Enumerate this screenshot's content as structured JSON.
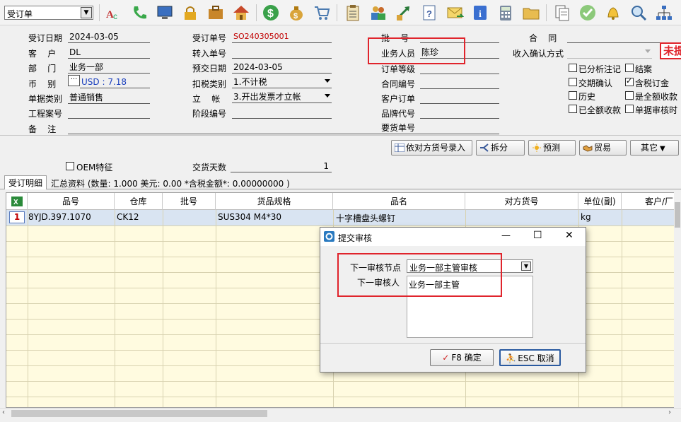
{
  "toolbar": {
    "doc_type": "受订单",
    "icons": [
      "spellcheck-icon",
      "phone-icon",
      "monitor-icon",
      "lock-icon",
      "briefcase-icon",
      "house-icon",
      "dollar-icon",
      "money-bag-icon",
      "cart-icon",
      "clipboard-icon",
      "users-icon",
      "transfer-icon",
      "help-doc-icon",
      "mail-icon",
      "info-icon",
      "calculator-icon",
      "folder-icon",
      "copy-doc-icon",
      "approve-icon",
      "bell-icon",
      "search-icon",
      "org-chart-icon"
    ]
  },
  "form": {
    "order_date_label": "受订日期",
    "order_date": "2024-03-05",
    "customer_label": "客    户",
    "customer": "DL",
    "dept_label": "部    门",
    "dept": "业务一部",
    "currency_label": "币    别",
    "currency": "USD : 7.18",
    "doc_category_label": "单据类别",
    "doc_category": "普通销售",
    "project_label": "工程案号",
    "project": "",
    "remark_label": "备    注",
    "remark": "",
    "order_no_label": "受订单号",
    "order_no": "SO240305001",
    "import_no_label": "转入单号",
    "import_no": "",
    "pre_date_label": "预交日期",
    "pre_date": "2024-03-05",
    "tax_type_label": "扣税类别",
    "tax_type": "1.不计税",
    "account_label": "立    帐",
    "account": "3.开出发票才立帐",
    "stage_label": "阶段编号",
    "stage": "",
    "batch_label": "批    号",
    "batch": "",
    "salesperson_label": "业务人员",
    "salesperson": "陈珍",
    "order_level_label": "订单等级",
    "order_level": "",
    "contract_no_label": "合同编号",
    "contract_no": "",
    "cust_order_label": "客户订单",
    "cust_order": "",
    "brand_label": "品牌代号",
    "brand": "",
    "req_no_label": "要货单号",
    "req_no": "",
    "contract_label": "合    同",
    "contract": "",
    "income_confirm_label": "收入确认方式",
    "income_confirm": "",
    "status_badge": "未提",
    "checkboxes": [
      {
        "label": "已分析注记",
        "checked": false
      },
      {
        "label": "结案",
        "checked": false
      },
      {
        "label": "交期确认",
        "checked": false
      },
      {
        "label": "含税订金",
        "checked": true
      },
      {
        "label": "历史",
        "checked": false
      },
      {
        "label": "是全额收款",
        "checked": false
      },
      {
        "label": "已全额收款",
        "checked": false
      },
      {
        "label": "单据审核时",
        "checked": false
      }
    ]
  },
  "actions": {
    "b1": "依对方货号录入",
    "b2": "拆分",
    "b3": "预测",
    "b4": "贸易",
    "b5": "其它"
  },
  "extra": {
    "oem_label": "OEM特征",
    "delivery_days_label": "交货天数",
    "delivery_days": "1"
  },
  "tabs": {
    "detail": "受订明细",
    "summary": "汇总资料 (数量: 1.000 美元: 0.00 *含税金额*: 0.00000000 )"
  },
  "grid": {
    "columns": [
      "品号",
      "仓库",
      "批号",
      "货品规格",
      "品名",
      "对方货号",
      "单位(副)",
      "客户/厂"
    ],
    "rows": [
      {
        "num": "1",
        "item_no": "8YJD.397.1070",
        "warehouse": "CK12",
        "batch": "",
        "spec": "SUS304 M4*30",
        "name": "十字槽盘头螺钉",
        "other_no": "",
        "unit": "kg",
        "cust": ""
      }
    ]
  },
  "dialog": {
    "title": "提交审核",
    "next_node_label": "下一审核节点",
    "next_node": "业务一部主管审核",
    "next_reviewer_label": "下一审核人",
    "next_reviewer": "业务一部主管",
    "ok_label": "F8 确定",
    "cancel_label": "ESC 取消",
    "minimize": "—",
    "maximize": "☐",
    "close": "✕"
  },
  "colors": {
    "highlight_red": "#e0242c",
    "row_selected": "#d9e4f2",
    "grid_bg": "#fffbe0"
  }
}
